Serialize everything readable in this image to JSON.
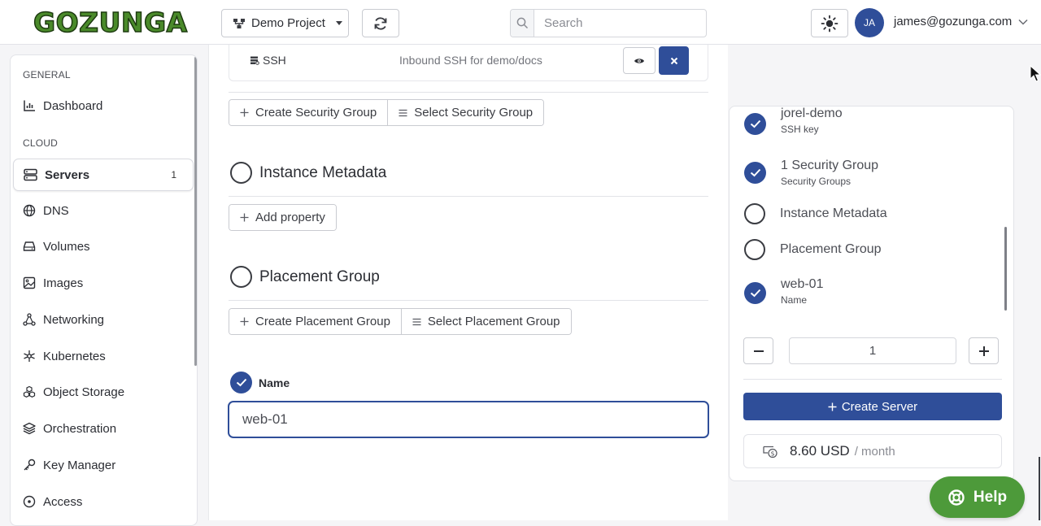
{
  "header": {
    "logo_text": "GOZUNGA",
    "project_label": "Demo Project",
    "search_placeholder": "Search",
    "avatar_initials": "JA",
    "user_email": "james@gozunga.com"
  },
  "sidebar": {
    "section_general": "GENERAL",
    "section_cloud": "CLOUD",
    "items": [
      {
        "label": "Dashboard",
        "icon": "bar-chart-icon"
      },
      {
        "label": "Servers",
        "icon": "server-icon",
        "count": "1",
        "active": true
      },
      {
        "label": "DNS",
        "icon": "globe-icon"
      },
      {
        "label": "Volumes",
        "icon": "drive-icon"
      },
      {
        "label": "Images",
        "icon": "image-icon"
      },
      {
        "label": "Networking",
        "icon": "network-icon"
      },
      {
        "label": "Kubernetes",
        "icon": "kubernetes-icon"
      },
      {
        "label": "Object Storage",
        "icon": "boxes-icon"
      },
      {
        "label": "Orchestration",
        "icon": "layers-icon"
      },
      {
        "label": "Key Manager",
        "icon": "key-icon"
      },
      {
        "label": "Access",
        "icon": "access-icon"
      }
    ]
  },
  "main": {
    "security_group_row": {
      "name": "SSH",
      "description": "Inbound SSH for demo/docs"
    },
    "create_security_group": "Create Security Group",
    "select_security_group": "Select Security Group",
    "instance_metadata_title": "Instance Metadata",
    "add_property": "Add property",
    "placement_group_title": "Placement Group",
    "create_placement_group": "Create Placement Group",
    "select_placement_group": "Select Placement Group",
    "name_label": "Name",
    "name_value": "web-01"
  },
  "summary": {
    "items": [
      {
        "title": "jorel-demo",
        "subtitle": "SSH key",
        "checked": true
      },
      {
        "title": "1 Security Group",
        "subtitle": "Security Groups",
        "checked": true
      },
      {
        "title": "Instance Metadata",
        "subtitle": "",
        "checked": false
      },
      {
        "title": "Placement Group",
        "subtitle": "",
        "checked": false
      },
      {
        "title": "web-01",
        "subtitle": "Name",
        "checked": true
      }
    ],
    "quantity": "1",
    "create_label": "Create Server",
    "price": "8.60 USD",
    "price_unit": "/ month"
  },
  "help_label": "Help",
  "colors": {
    "primary": "#2f4e99",
    "brand_green": "#4d9a3a"
  }
}
